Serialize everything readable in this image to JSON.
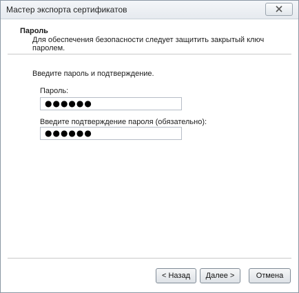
{
  "window": {
    "title": "Мастер экспорта сертификатов"
  },
  "header": {
    "title": "Пароль",
    "description": "Для обеспечения безопасности следует защитить закрытый ключ паролем."
  },
  "form": {
    "prompt": "Введите пароль и подтверждение.",
    "password_label": "Пароль:",
    "password_value": "●●●●●●",
    "confirm_label": "Введите подтверждение пароля (обязательно):",
    "confirm_value": "●●●●●●"
  },
  "buttons": {
    "back": "< Назад",
    "next": "Далее >",
    "cancel": "Отмена"
  },
  "icons": {
    "close": "close-icon"
  }
}
